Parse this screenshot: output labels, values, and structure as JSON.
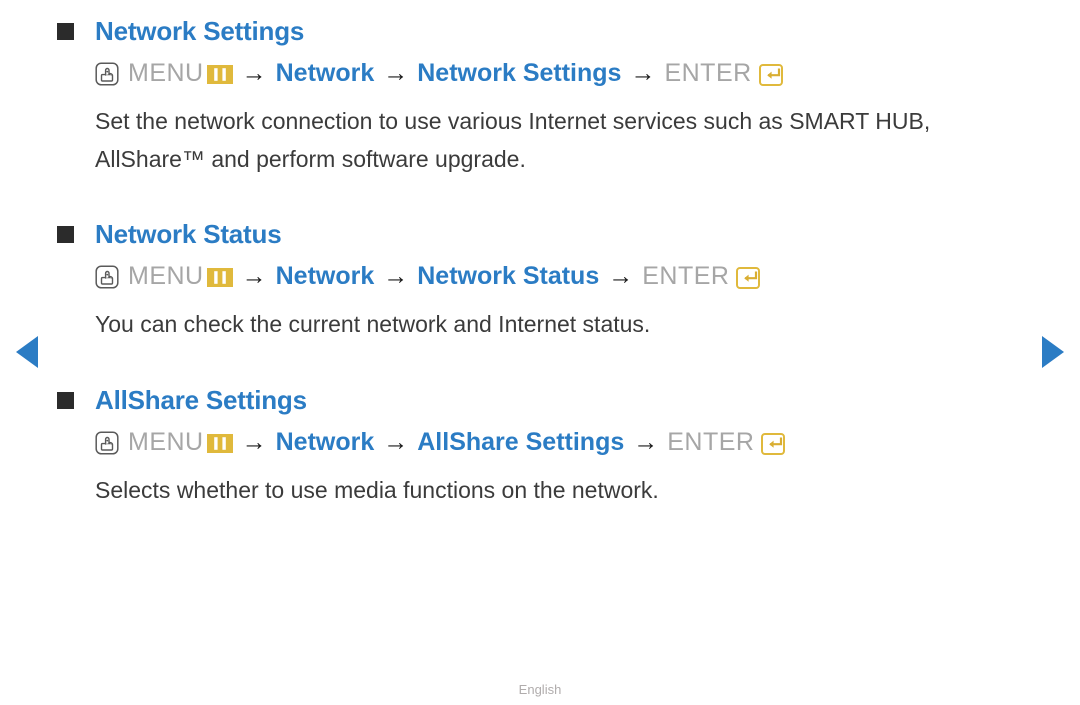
{
  "nav": {
    "prev_icon": "triangle-left-icon",
    "next_icon": "triangle-right-icon",
    "accent_color": "#2b7cc4"
  },
  "colors": {
    "heading_blue": "#2b7cc4",
    "menu_gray": "#a6a6a6",
    "body_text": "#3b3b3b",
    "bullet": "#2b2b2b",
    "icon_gold": "#e0b93c",
    "footer_gray": "#b0acac"
  },
  "sections": [
    {
      "title": "Network Settings",
      "path": {
        "menu_label": "MENU",
        "steps": [
          "Network",
          "Network Settings"
        ],
        "enter_label": "ENTER",
        "arrow": "→"
      },
      "description": "Set the network connection to use various Internet services such as SMART HUB, AllShare™ and perform software upgrade."
    },
    {
      "title": "Network Status",
      "path": {
        "menu_label": "MENU",
        "steps": [
          "Network",
          "Network Status"
        ],
        "enter_label": "ENTER",
        "arrow": "→"
      },
      "description": "You can check the current network and Internet status."
    },
    {
      "title": "AllShare Settings",
      "path": {
        "menu_label": "MENU",
        "steps": [
          "Network",
          "AllShare Settings"
        ],
        "enter_label": "ENTER",
        "arrow": "→"
      },
      "description": "Selects whether to use media functions on the network."
    }
  ],
  "footer": {
    "language": "English"
  }
}
